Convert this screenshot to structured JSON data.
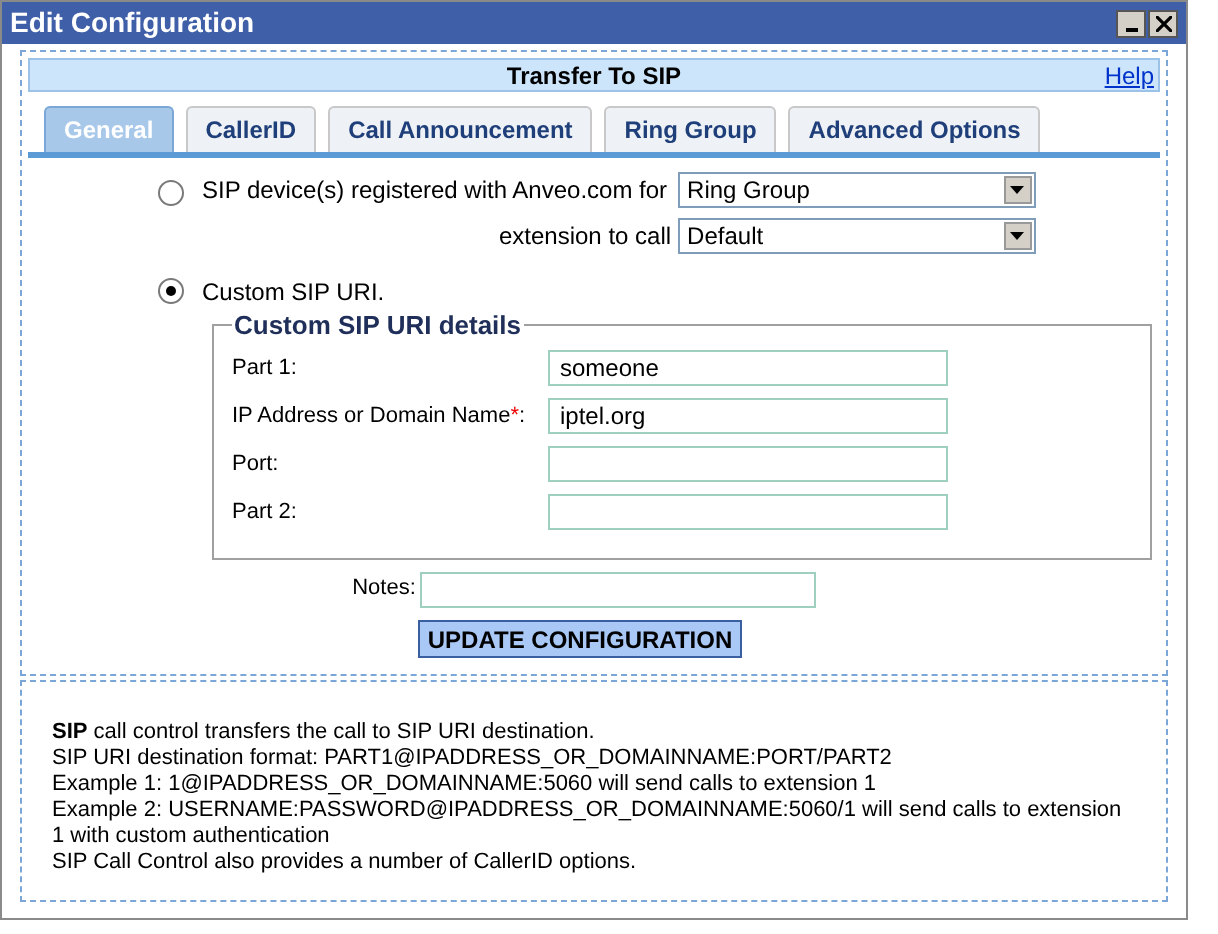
{
  "window": {
    "title": "Edit Configuration"
  },
  "header": {
    "title": "Transfer To SIP",
    "help": "Help"
  },
  "tabs": [
    {
      "label": "General",
      "selected": true
    },
    {
      "label": "CallerID",
      "selected": false
    },
    {
      "label": "Call Announcement",
      "selected": false
    },
    {
      "label": "Ring Group",
      "selected": false
    },
    {
      "label": "Advanced Options",
      "selected": false
    }
  ],
  "options": [
    {
      "label": "SIP device(s) registered with Anveo.com for",
      "selected": false,
      "selects": [
        {
          "value": "Ring Group"
        },
        {
          "label": "extension to call",
          "value": "Default"
        }
      ]
    },
    {
      "label": "Custom SIP URI.",
      "selected": true
    }
  ],
  "details": {
    "legend": "Custom SIP URI details",
    "fields": [
      {
        "label": "Part 1:",
        "required": false,
        "value": "someone"
      },
      {
        "label": "IP Address or Domain Name",
        "required": true,
        "value": "iptel.org"
      },
      {
        "label": "Port:",
        "required": false
      },
      {
        "label": "Part 2:",
        "required": false
      }
    ],
    "required_mark": "*",
    "required_suffix": ":"
  },
  "notes": {
    "label": "Notes:"
  },
  "submit": "UPDATE CONFIGURATION",
  "info": [
    "**SIP** call control transfers the call to SIP URI destination.",
    "SIP URI destination format: PART1@IPADDRESS_OR_DOMAINNAME:PORT/PART2",
    "Example 1: 1@IPADDRESS_OR_DOMAINNAME:5060 will send calls to extension 1",
    "Example 2: USERNAME:PASSWORD@IPADDRESS_OR_DOMAINNAME:5060/1 will send calls to extension 1 with custom authentication",
    "SIP Call Control also provides a number of CallerID options."
  ]
}
